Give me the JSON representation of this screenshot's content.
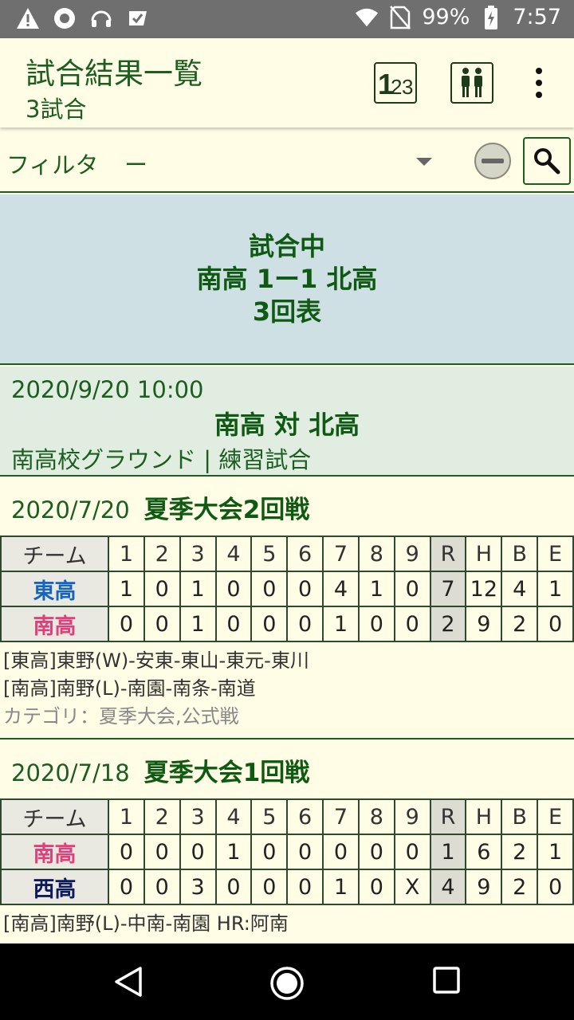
{
  "status": {
    "battery": "99%",
    "time": "7:57"
  },
  "appbar": {
    "title": "試合結果一覧",
    "subtitle": "3試合"
  },
  "filter": {
    "label": "フィルタ",
    "value": "ー"
  },
  "live": {
    "status": "試合中",
    "score": "南高 1ー1 北高",
    "inning": "3回表"
  },
  "upcoming": {
    "datetime": "2020/9/20 10:00",
    "match": "南高 対 北高",
    "venue": "南高校グラウンド | 練習試合"
  },
  "games": [
    {
      "date": "2020/7/20",
      "event": "夏季大会2回戦",
      "header": [
        "チーム",
        "1",
        "2",
        "3",
        "4",
        "5",
        "6",
        "7",
        "8",
        "9",
        "R",
        "H",
        "B",
        "E"
      ],
      "rows": [
        {
          "team": "東高",
          "color": "#1565c0",
          "cells": [
            "1",
            "0",
            "1",
            "0",
            "0",
            "0",
            "4",
            "1",
            "0",
            "7",
            "12",
            "4",
            "1"
          ]
        },
        {
          "team": "南高",
          "color": "#e0407a",
          "cells": [
            "0",
            "0",
            "1",
            "0",
            "0",
            "0",
            "1",
            "0",
            "0",
            "2",
            "9",
            "2",
            "0"
          ]
        }
      ],
      "notes": [
        "[東高]東野(W)-安東-東山-東元-東川",
        "[南高]南野(L)-南園-南条-南道"
      ],
      "category": "カテゴリ：夏季大会,公式戦"
    },
    {
      "date": "2020/7/18",
      "event": "夏季大会1回戦",
      "header": [
        "チーム",
        "1",
        "2",
        "3",
        "4",
        "5",
        "6",
        "7",
        "8",
        "9",
        "R",
        "H",
        "B",
        "E"
      ],
      "rows": [
        {
          "team": "南高",
          "color": "#e0407a",
          "cells": [
            "0",
            "0",
            "0",
            "1",
            "0",
            "0",
            "0",
            "0",
            "0",
            "1",
            "6",
            "2",
            "1"
          ]
        },
        {
          "team": "西高",
          "color": "#0d1b5e",
          "cells": [
            "0",
            "0",
            "3",
            "0",
            "0",
            "0",
            "1",
            "0",
            "X",
            "4",
            "9",
            "2",
            "0"
          ]
        }
      ],
      "notes": [
        "[南高]南野(L)-中南-南園 HR:阿南"
      ]
    }
  ]
}
